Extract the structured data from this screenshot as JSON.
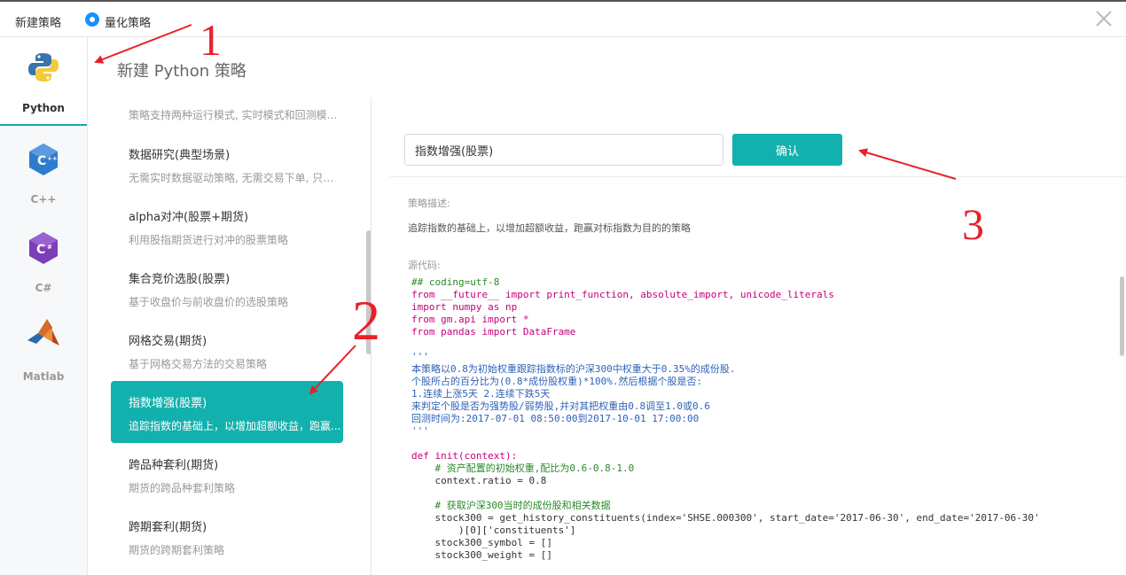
{
  "header": {
    "title": "新建策略",
    "mode_label": "量化策略"
  },
  "languages": [
    {
      "label": "Python",
      "icon": "python-icon",
      "active": true
    },
    {
      "label": "C++",
      "icon": "cpp-icon",
      "active": false
    },
    {
      "label": "C#",
      "icon": "csharp-icon",
      "active": false
    },
    {
      "label": "Matlab",
      "icon": "matlab-icon",
      "active": false
    }
  ],
  "page_heading": "新建 Python 策略",
  "strategies": {
    "intro": "策略支持两种运行模式, 实时模式和回测模...",
    "items": [
      {
        "title": "数据研究(典型场景)",
        "desc": "无需实时数据驱动策略, 无需交易下单, 只是..."
      },
      {
        "title": "alpha对冲(股票+期货)",
        "desc": "利用股指期货进行对冲的股票策略"
      },
      {
        "title": "集合竞价选股(股票)",
        "desc": "基于收盘价与前收盘价的选股策略"
      },
      {
        "title": "网格交易(期货)",
        "desc": "基于网格交易方法的交易策略"
      },
      {
        "title": "指数增强(股票)",
        "desc": "追踪指数的基础上，以增加超额收益，跑赢...",
        "active": true
      },
      {
        "title": "跨品种套利(期货)",
        "desc": "期货的跨品种套利策略"
      },
      {
        "title": "跨期套利(期货)",
        "desc": "期货的跨期套利策略"
      }
    ]
  },
  "form": {
    "name_value": "指数增强(股票)",
    "confirm_label": "确认"
  },
  "description": {
    "label": "策略描述:",
    "text": "追踪指数的基础上，以增加超额收益，跑赢对标指数为目的的策略"
  },
  "source": {
    "label": "源代码:",
    "lines": [
      "## coding=utf-8",
      "from __future__ import print_function, absolute_import, unicode_literals",
      "import numpy as np",
      "from gm.api import *",
      "from pandas import DataFrame",
      "",
      "'''",
      "本策略以0.8为初始权重跟踪指数标的沪深300中权重大于0.35%的成份股.",
      "个股所占的百分比为(0.8*成份股权重)*100%.然后根据个股是否:",
      "1.连续上涨5天 2.连续下跌5天",
      "来判定个股是否为强势股/弱势股,并对其把权重由0.8调至1.0或0.6",
      "回测时间为:2017-07-01 08:50:00到2017-10-01 17:00:00",
      "'''",
      "",
      "def init(context):",
      "    # 资产配置的初始权重,配比为0.6-0.8-1.0",
      "    context.ratio = 0.8",
      "",
      "    # 获取沪深300当时的成份股和相关数据",
      "    stock300 = get_history_constituents(index='SHSE.000300', start_date='2017-06-30', end_date='2017-06-30'",
      "        )[0]['constituents']",
      "    stock300_symbol = []",
      "    stock300_weight = []"
    ]
  },
  "annotations": [
    "1",
    "2",
    "3"
  ],
  "colors": {
    "accent": "#13b1ad",
    "annotation": "#e8202a",
    "radio": "#1890ff"
  }
}
